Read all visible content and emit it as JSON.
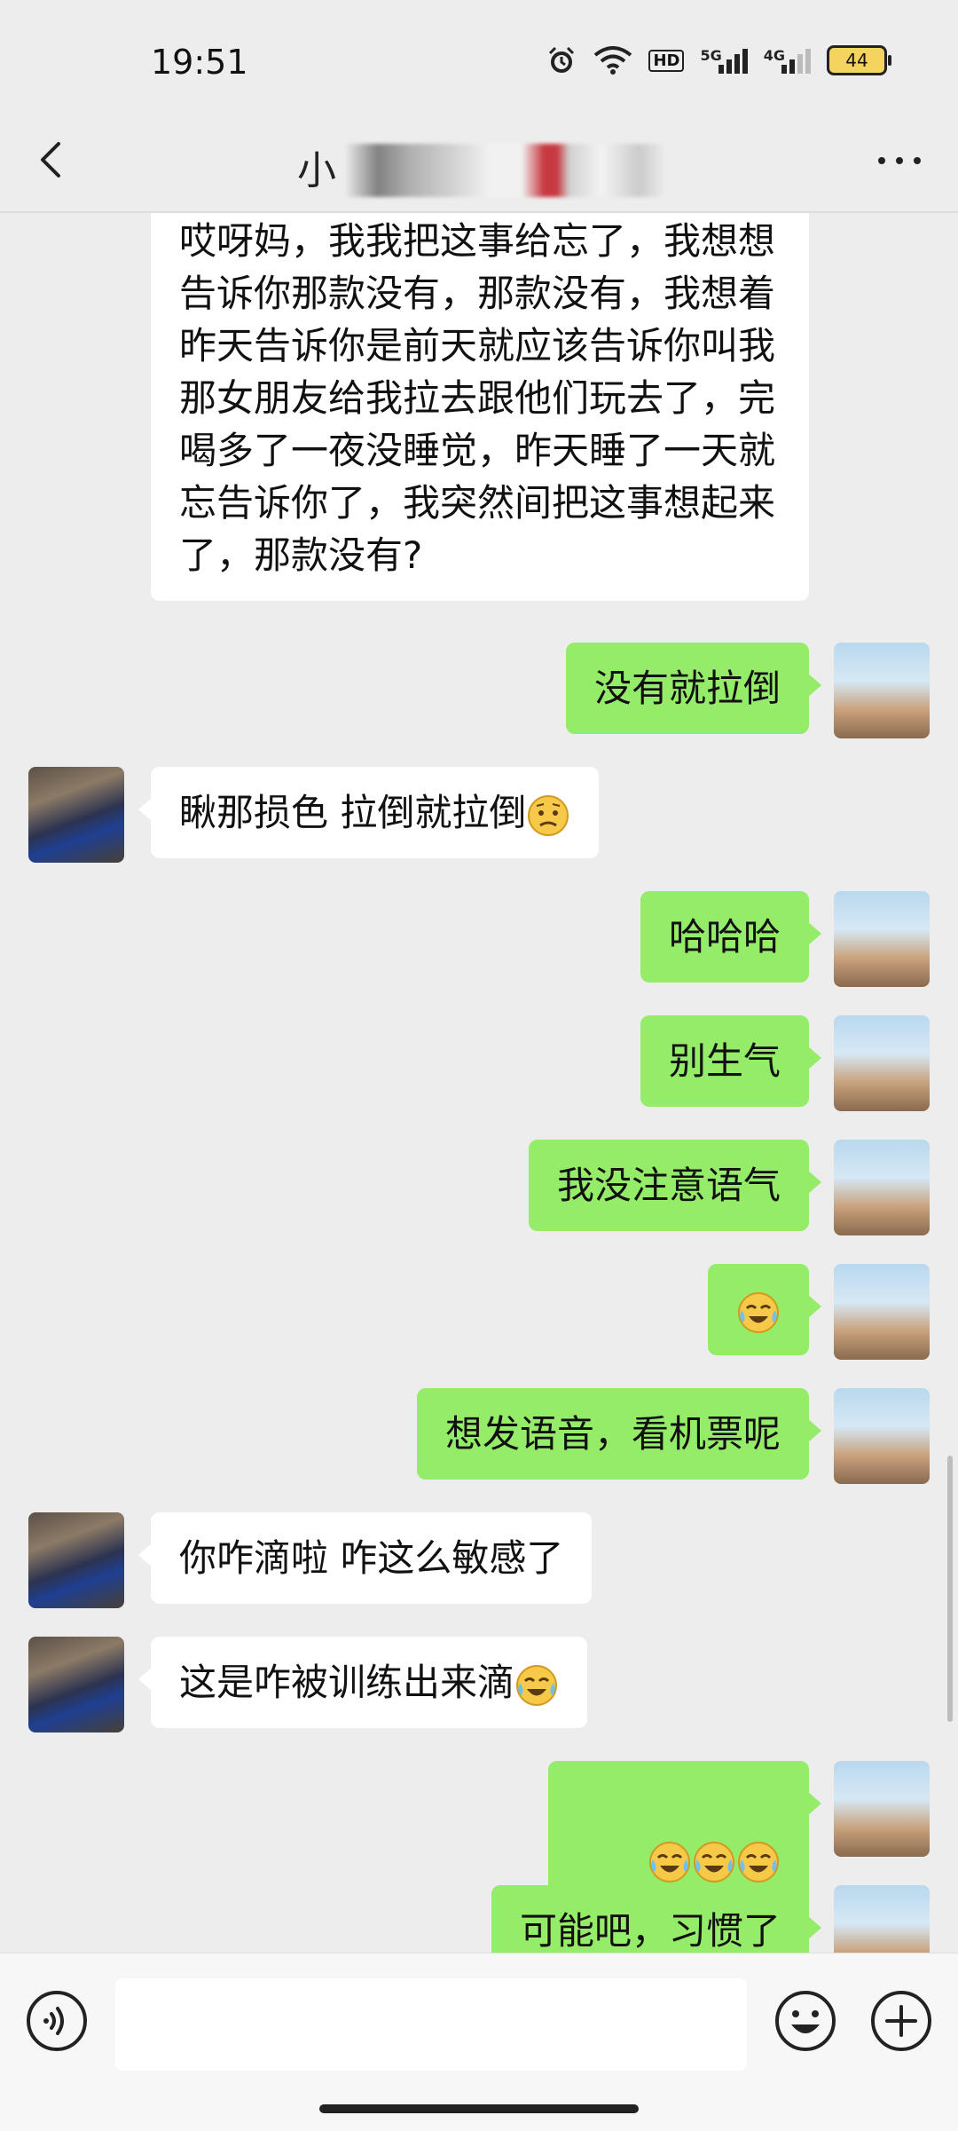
{
  "status_bar": {
    "time": "19:51",
    "icons": [
      "alarm-icon",
      "wifi-icon",
      "hd-icon",
      "signal-5g-icon",
      "signal-4g-icon",
      "battery-icon"
    ],
    "hd_label": "HD",
    "net1_label": "5G",
    "net2_label": "4G",
    "battery_level": "44"
  },
  "nav": {
    "title_visible": "小",
    "back_icon": "chevron-left-icon",
    "more_icon": "more-dots-icon"
  },
  "messages": [
    {
      "side": "left",
      "text": "哎呀妈，我我把这事给忘了，我想想告诉你那款没有，那款没有，我想着昨天告诉你是前天就应该告诉你叫我那女朋友给我拉去跟他们玩去了，完喝多了一夜没睡觉，昨天睡了一天就忘告诉你了，我突然间把这事想起来了，那款没有?"
    },
    {
      "side": "right",
      "text": "没有就拉倒"
    },
    {
      "side": "left",
      "text": "瞅那损色 拉倒就拉倒",
      "emoji": "confused-face-emoji"
    },
    {
      "side": "right",
      "text": "哈哈哈"
    },
    {
      "side": "right",
      "text": "别生气"
    },
    {
      "side": "right",
      "text": "我没注意语气"
    },
    {
      "side": "right",
      "text": "",
      "emoji": "crying-laughing-emoji"
    },
    {
      "side": "right",
      "text": "想发语音，看机票呢"
    },
    {
      "side": "left",
      "text": "你咋滴啦 咋这么敏感了"
    },
    {
      "side": "left",
      "text": "这是咋被训练出来滴",
      "emoji": "crying-laughing-emoji"
    },
    {
      "side": "right",
      "text": "",
      "emoji": "crying-laughing-emoji x3"
    },
    {
      "side": "right",
      "text": "可能吧，习惯了"
    }
  ],
  "input": {
    "placeholder": "",
    "voice_icon": "voice-icon",
    "emoji_icon": "emoji-face-icon",
    "plus_icon": "plus-icon"
  },
  "colors": {
    "background": "#ededed",
    "my_bubble": "#95ec69",
    "their_bubble": "#ffffff"
  }
}
